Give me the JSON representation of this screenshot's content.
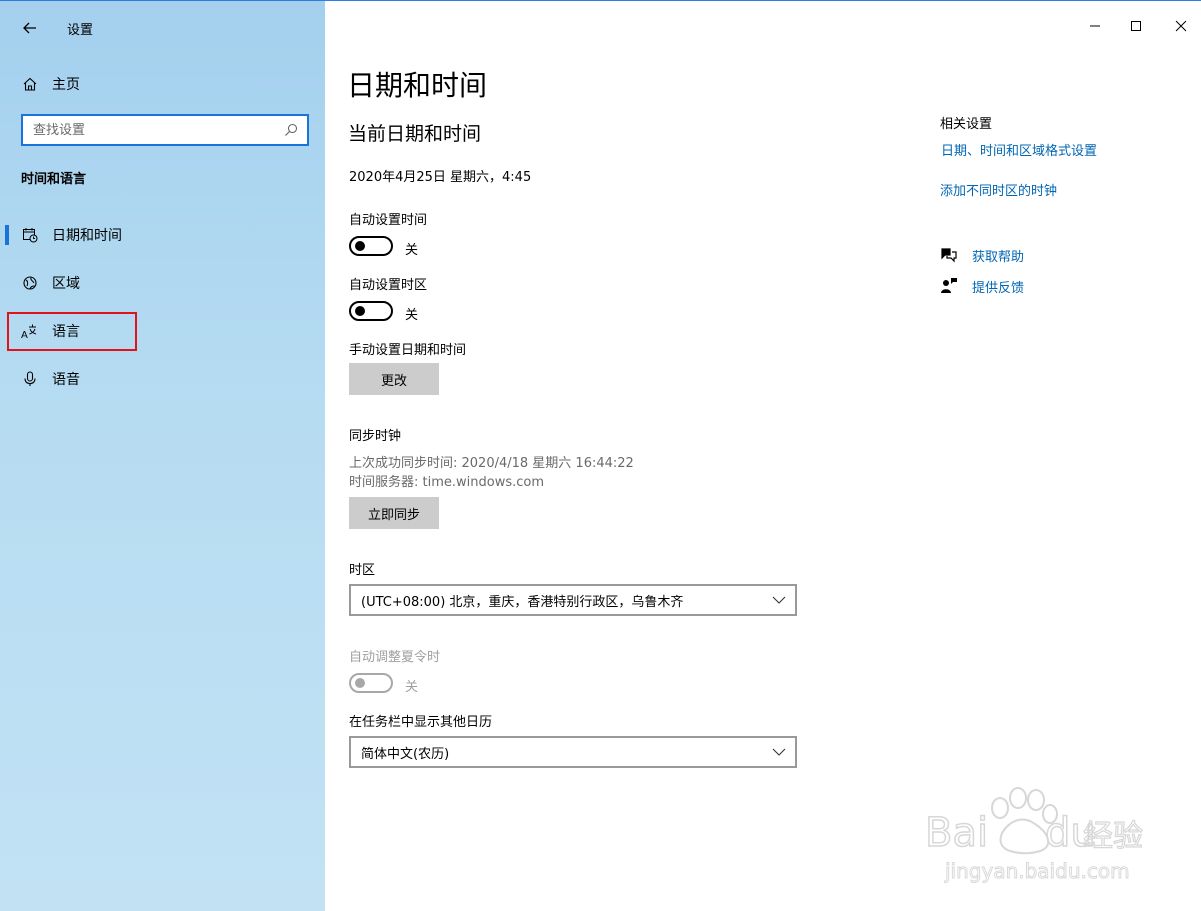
{
  "window": {
    "title": "设置",
    "controls": {
      "minimize": "minimize-icon",
      "maximize": "maximize-icon",
      "close": "close-icon"
    }
  },
  "sidebar": {
    "home_label": "主页",
    "search": {
      "placeholder": "查找设置",
      "value": ""
    },
    "section_title": "时间和语言",
    "items": [
      {
        "label": "日期和时间",
        "icon": "calendar-clock-icon",
        "active": true
      },
      {
        "label": "区域",
        "icon": "globe-icon",
        "active": false
      },
      {
        "label": "语言",
        "icon": "language-icon",
        "active": false
      },
      {
        "label": "语音",
        "icon": "microphone-icon",
        "active": false
      }
    ]
  },
  "main": {
    "page_title": "日期和时间",
    "current_section": {
      "title": "当前日期和时间",
      "datetime": "2020年4月25日 星期六，4:45"
    },
    "auto_time": {
      "label": "自动设置时间",
      "state_text": "关",
      "on": false
    },
    "auto_timezone": {
      "label": "自动设置时区",
      "state_text": "关",
      "on": false
    },
    "manual": {
      "label": "手动设置日期和时间",
      "button": "更改"
    },
    "sync": {
      "title": "同步时钟",
      "last_sync": "上次成功同步时间: 2020/4/18 星期六 16:44:22",
      "server": "时间服务器: time.windows.com",
      "button": "立即同步"
    },
    "timezone": {
      "label": "时区",
      "value": "(UTC+08:00) 北京，重庆，香港特别行政区，乌鲁木齐"
    },
    "dst": {
      "label": "自动调整夏令时",
      "state_text": "关",
      "on": false,
      "disabled": true
    },
    "calendar": {
      "label": "在任务栏中显示其他日历",
      "value": "简体中文(农历)"
    }
  },
  "related": {
    "title": "相关设置",
    "links": [
      "日期、时间和区域格式设置",
      "添加不同时区的时钟"
    ],
    "help": "获取帮助",
    "feedback": "提供反馈"
  },
  "watermark": {
    "brand": "Bai du 经验",
    "url": "jingyan.baidu.com"
  },
  "colors": {
    "accent": "#1a73d9",
    "link": "#0066b4",
    "highlight": "#e0131a"
  }
}
